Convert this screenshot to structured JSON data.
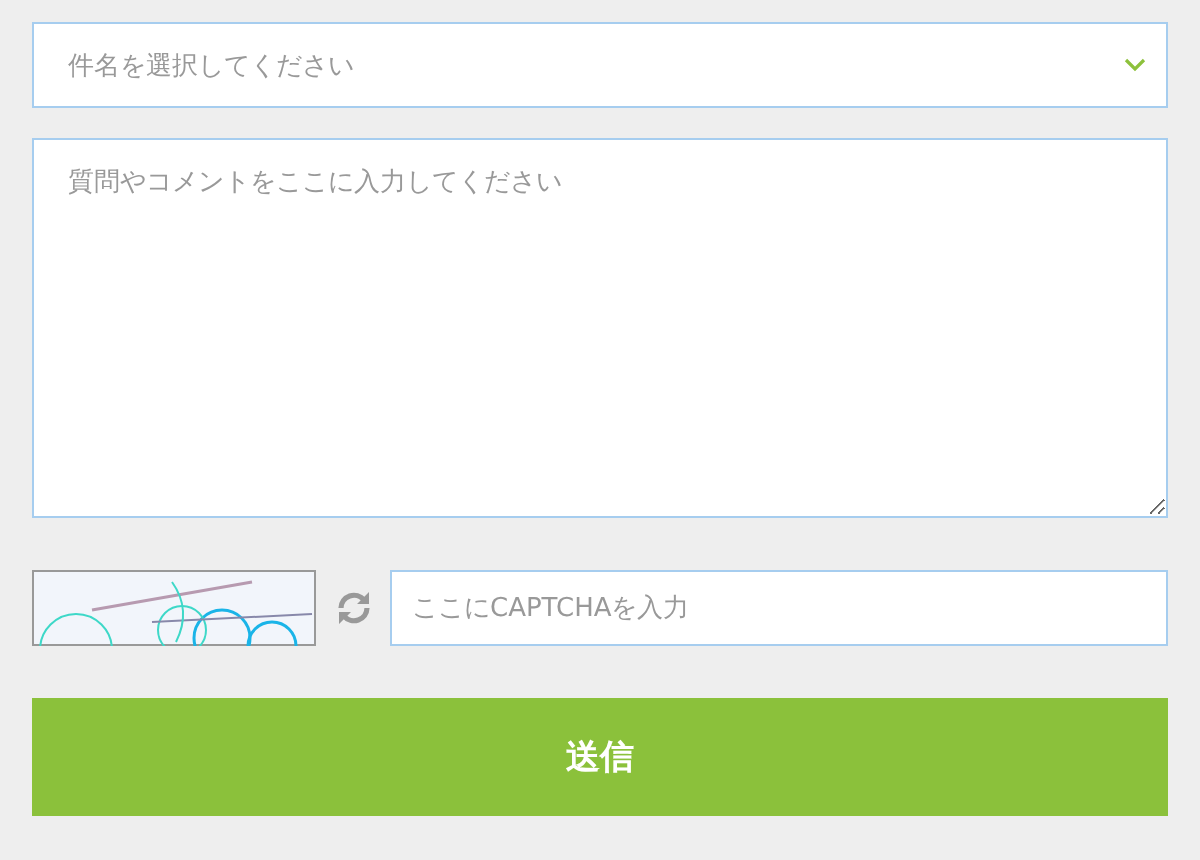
{
  "subject_select": {
    "placeholder": "件名を選択してください"
  },
  "comment_field": {
    "placeholder": "質問やコメントをここに入力してください"
  },
  "captcha": {
    "input": {
      "placeholder": "ここにCAPTCHAを入力"
    }
  },
  "submit_button": {
    "label": "送信"
  }
}
